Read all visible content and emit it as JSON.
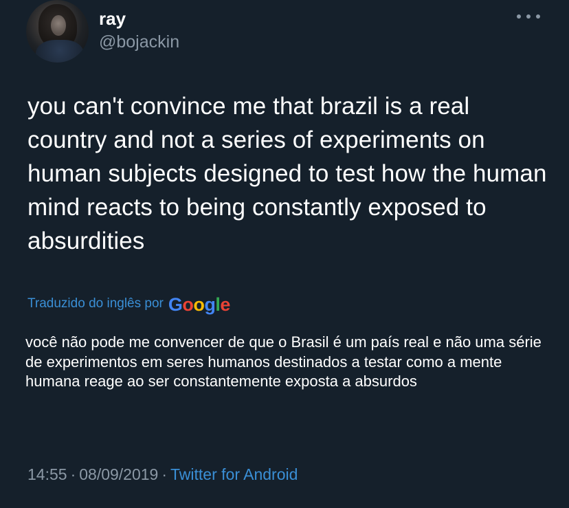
{
  "user": {
    "name": "ray",
    "handle": "@bojackin"
  },
  "tweet": {
    "text": "you can't convince me that brazil is a real country and not a series of experiments on human subjects designed to test how the human mind reacts to being constantly exposed to absurdities"
  },
  "translation": {
    "label": "Traduzido do inglês por",
    "provider": "Google",
    "text": "você não pode me convencer de que o Brasil é um país real e não uma série de experimentos em seres humanos destinados a testar como a mente humana reage ao ser constantemente exposta a absurdos"
  },
  "meta": {
    "time": "14:55",
    "date": "08/09/2019",
    "separator": "·",
    "source": "Twitter for Android"
  },
  "colors": {
    "background": "#15202b",
    "primary_text": "#ffffff",
    "secondary_text": "#8b98a5",
    "link": "#3a8fd6"
  },
  "icons": {
    "more": "more-horizontal-icon",
    "avatar": "avatar"
  }
}
